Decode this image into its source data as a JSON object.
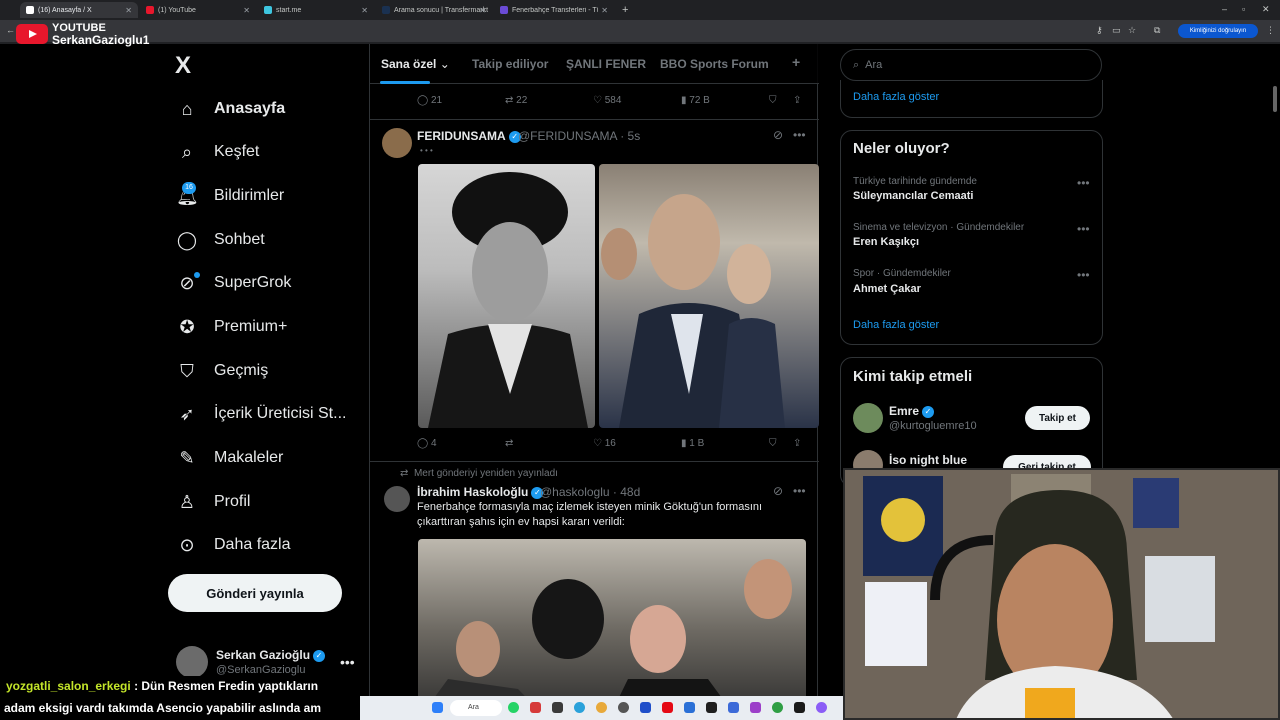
{
  "browser": {
    "tabs": [
      {
        "label": "(16) Anasayfa / X",
        "active": true
      },
      {
        "label": "(1) YouTube"
      },
      {
        "label": "start.me"
      },
      {
        "label": "Arama sonucu | Transfermarkt"
      },
      {
        "label": "Fenerbahçe Transferleri - Tüm S..."
      }
    ],
    "new_tab": "+",
    "verify_label": "Kimliğinizi doğrulayın"
  },
  "stream_overlay": {
    "brand": "YOUTUBE",
    "channel": "SerkanGazioglu1"
  },
  "sidebar": {
    "logo": "X",
    "items": [
      {
        "label": "Anasayfa",
        "icon": "home-icon"
      },
      {
        "label": "Keşfet",
        "icon": "search-icon"
      },
      {
        "label": "Bildirimler",
        "icon": "bell-icon"
      },
      {
        "label": "Sohbet",
        "icon": "chat-icon"
      },
      {
        "label": "SuperGrok",
        "icon": "grok-icon"
      },
      {
        "label": "Premium+",
        "icon": "premium-icon"
      },
      {
        "label": "Geçmiş",
        "icon": "bookmark-icon"
      },
      {
        "label": "İçerik Üreticisi St...",
        "icon": "rocket-icon"
      },
      {
        "label": "Makaleler",
        "icon": "article-icon"
      },
      {
        "label": "Profil",
        "icon": "profile-icon"
      },
      {
        "label": "Daha fazla",
        "icon": "more-icon"
      }
    ],
    "notification_count": "16",
    "post_button": "Gönderi yayınla",
    "account": {
      "name": "Serkan Gazioğlu",
      "handle": "@SerkanGazioglu"
    }
  },
  "timeline": {
    "tabs": [
      "Sana özel",
      "Takip ediliyor",
      "ŞANLI FENER",
      "BBO Sports Forum"
    ],
    "add_tab": "+",
    "prev_post_actions": {
      "replies": "21",
      "reposts": "22",
      "likes": "584",
      "views": "72 B"
    },
    "post1": {
      "name": "FERIDUNSAMA",
      "handle": "@FERIDUNSAMA",
      "time": "5s",
      "text": "• • •",
      "actions": {
        "replies": "4",
        "reposts": "",
        "likes": "16",
        "views": "1 B"
      }
    },
    "post2": {
      "repost_label": "Mert gönderiyi yeniden yayınladı",
      "name": "İbrahim Haskoloğlu",
      "handle": "@haskologlu",
      "time": "48d",
      "text": "Fenerbahçe formasıyla maç izlemek isteyen minik Göktuğ'un formasını çıkarttıran şahıs için ev hapsi kararı verildi:"
    }
  },
  "right": {
    "search_placeholder": "Ara",
    "show_more": "Daha fazla göster",
    "whats_happening": {
      "title": "Neler oluyor?",
      "trends": [
        {
          "meta": "Türkiye tarihinde gündemde",
          "name": "Süleymancılar Cemaati"
        },
        {
          "meta": "Sinema ve televizyon · Gündemdekiler",
          "name": "Eren Kaşıkçı"
        },
        {
          "meta": "Spor · Gündemdekiler",
          "name": "Ahmet Çakar"
        }
      ],
      "show_more": "Daha fazla göster"
    },
    "who_to_follow": {
      "title": "Kimi takip etmeli",
      "users": [
        {
          "name": "Emre",
          "handle": "@kurtogluemre10",
          "button": "Takip et"
        },
        {
          "name": "İso night blue",
          "handle": "",
          "button": "Geri takip et"
        }
      ]
    }
  },
  "chat": {
    "line1_user": "yozgatli_salon_erkegi",
    "line1_text": ": Dün Resmen Fredin yaptıkların",
    "line2_text": "adam eksigi vardı takımda Asencio yapabilir aslında am"
  },
  "taskbar": {
    "search_label": "Ara"
  },
  "colors": {
    "accent": "#1d9bf0",
    "chat_user": "#c4e62a",
    "background": "#000000"
  }
}
